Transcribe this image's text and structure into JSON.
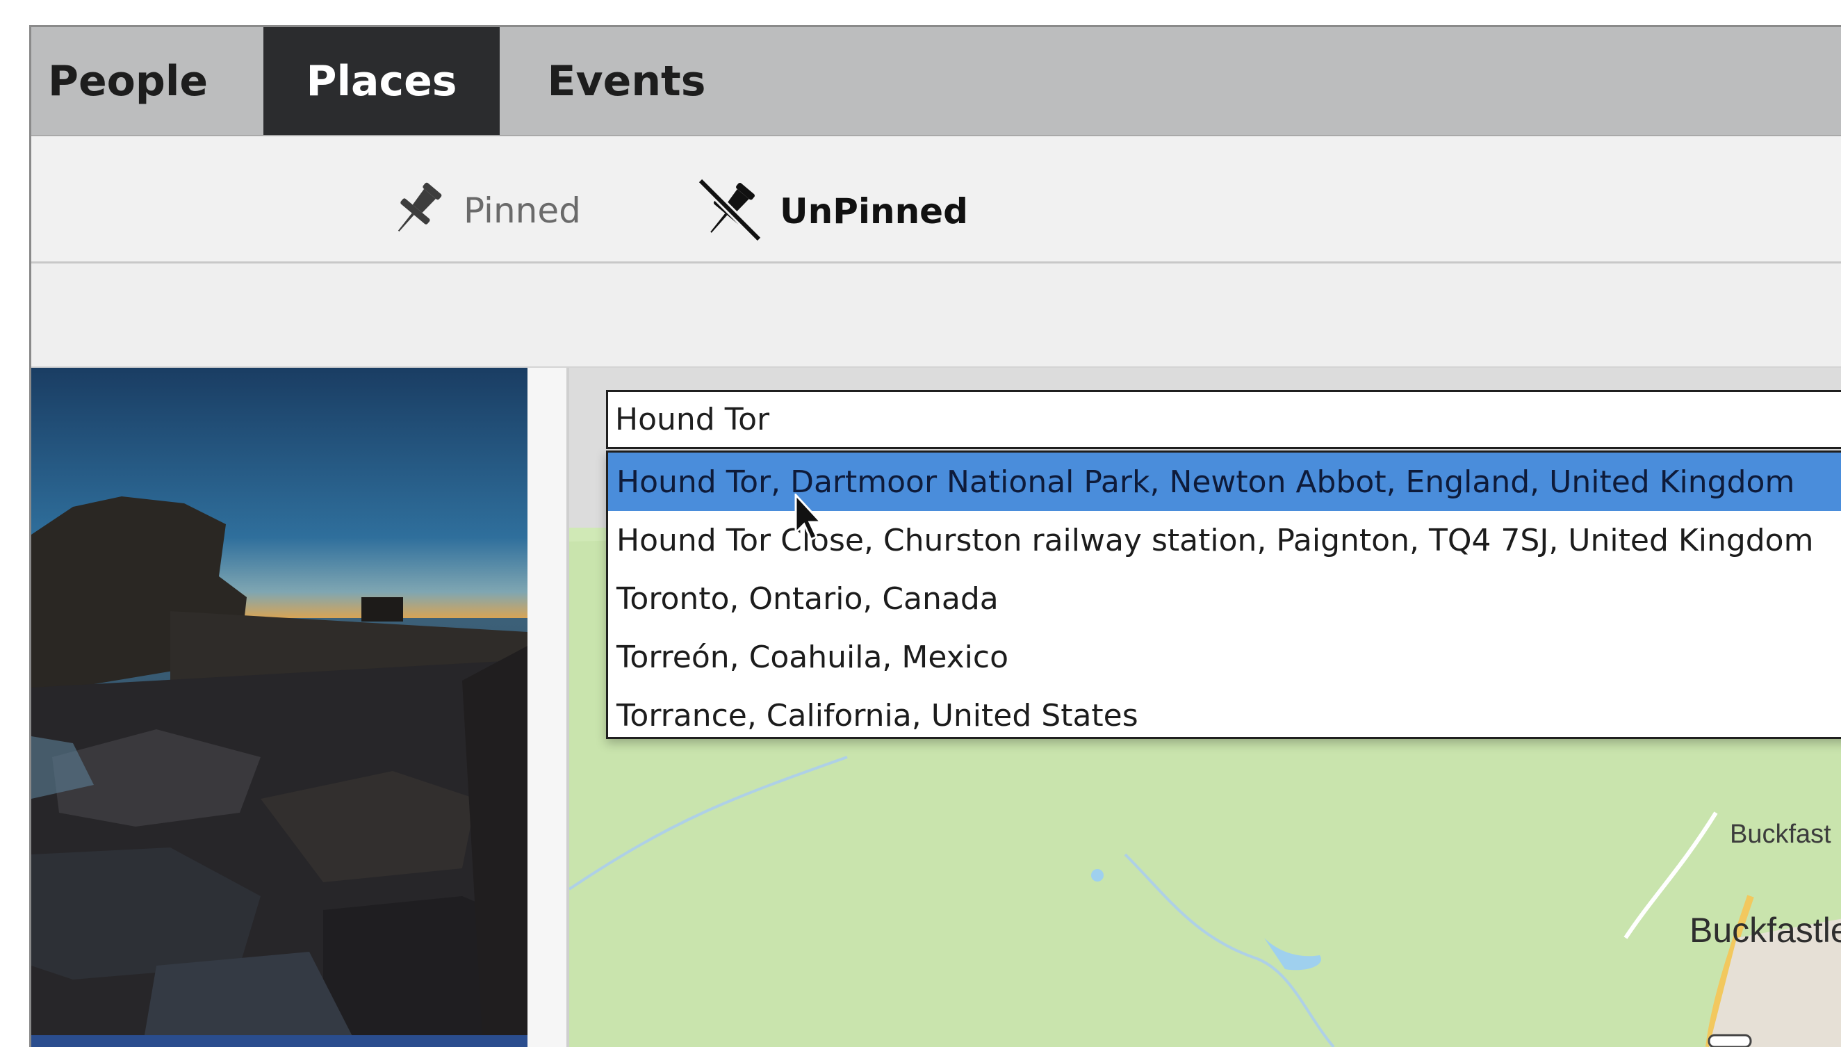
{
  "tabs": [
    {
      "label": "People",
      "active": false
    },
    {
      "label": "Places",
      "active": true
    },
    {
      "label": "Events",
      "active": false
    }
  ],
  "pin_toggle": {
    "pinned_label": "Pinned",
    "unpinned_label": "UnPinned",
    "active": "UnPinned",
    "pinned_icon": "pin-icon",
    "unpinned_icon": "unpin-icon"
  },
  "search": {
    "value": "Hound Tor"
  },
  "suggestions": [
    "Hound Tor, Dartmoor National Park, Newton Abbot, England, United Kingdom",
    "Hound Tor Close, Churston railway station, Paignton, TQ4 7SJ, United Kingdom",
    "Toronto, Ontario, Canada",
    "Torreón, Coahuila, Mexico",
    "Torrance, California, United States"
  ],
  "selected_suggestion": 0,
  "map": {
    "labels": [
      "Buckfast",
      "Buckfastlei"
    ]
  },
  "colors": {
    "active_tab_bg": "#2b2c2e",
    "selection_highlight": "#4a8ddb",
    "map_green": "#d0e9b6"
  }
}
